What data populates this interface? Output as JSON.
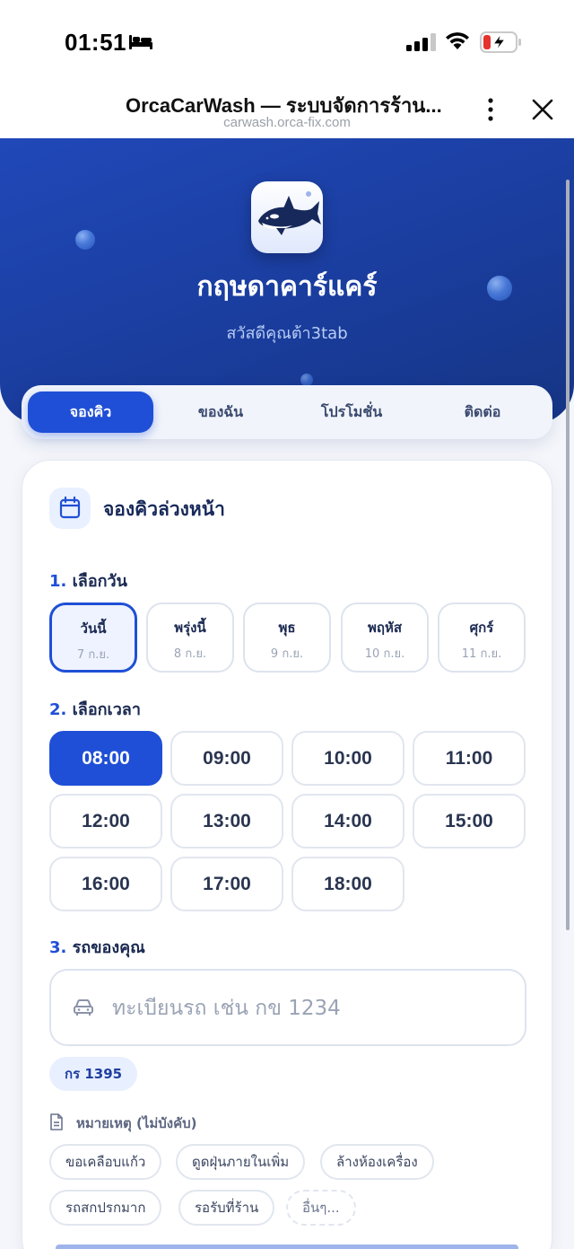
{
  "status_bar": {
    "time": "01:51"
  },
  "browser": {
    "title": "OrcaCarWash — ระบบจัดการร้าน...",
    "url": "carwash.orca-fix.com"
  },
  "hero": {
    "shop_name": "กฤษดาคาร์แคร์",
    "greeting": "สวัสดีคุณต้า3tab"
  },
  "tabs": [
    {
      "label": "จองคิว",
      "active": true
    },
    {
      "label": "ของฉัน",
      "active": false
    },
    {
      "label": "โปรโมชั่น",
      "active": false
    },
    {
      "label": "ติดต่อ",
      "active": false
    }
  ],
  "booking": {
    "title": "จองคิวล่วงหน้า",
    "step1": {
      "num": "1.",
      "label": "เลือกวัน"
    },
    "days": [
      {
        "name": "วันนี้",
        "date": "7 ก.ย.",
        "selected": true
      },
      {
        "name": "พรุ่งนี้",
        "date": "8 ก.ย.",
        "selected": false
      },
      {
        "name": "พุธ",
        "date": "9 ก.ย.",
        "selected": false
      },
      {
        "name": "พฤหัส",
        "date": "10 ก.ย.",
        "selected": false
      },
      {
        "name": "ศุกร์",
        "date": "11 ก.ย.",
        "selected": false
      }
    ],
    "step2": {
      "num": "2.",
      "label": "เลือกเวลา"
    },
    "times": [
      "08:00",
      "09:00",
      "10:00",
      "11:00",
      "12:00",
      "13:00",
      "14:00",
      "15:00",
      "16:00",
      "17:00",
      "18:00"
    ],
    "selected_time": "08:00",
    "step3": {
      "num": "3.",
      "label": "รถของคุณ"
    },
    "plate_placeholder": "ทะเบียนรถ เช่น กข 1234",
    "plate_value": "",
    "saved_plate": "กร 1395",
    "note_label": "หมายเหตุ (ไม่บังคับ)",
    "note_chips": [
      "ขอเคลือบแก้ว",
      "ดูดฝุ่นภายในเพิ่ม",
      "ล้างห้องเครื่อง",
      "รถสกปรกมาก",
      "รอรับที่ร้าน",
      "อื่นๆ..."
    ]
  },
  "colors": {
    "primary": "#1f4fd6",
    "hero_dark": "#163584",
    "text": "#1b2a52"
  }
}
